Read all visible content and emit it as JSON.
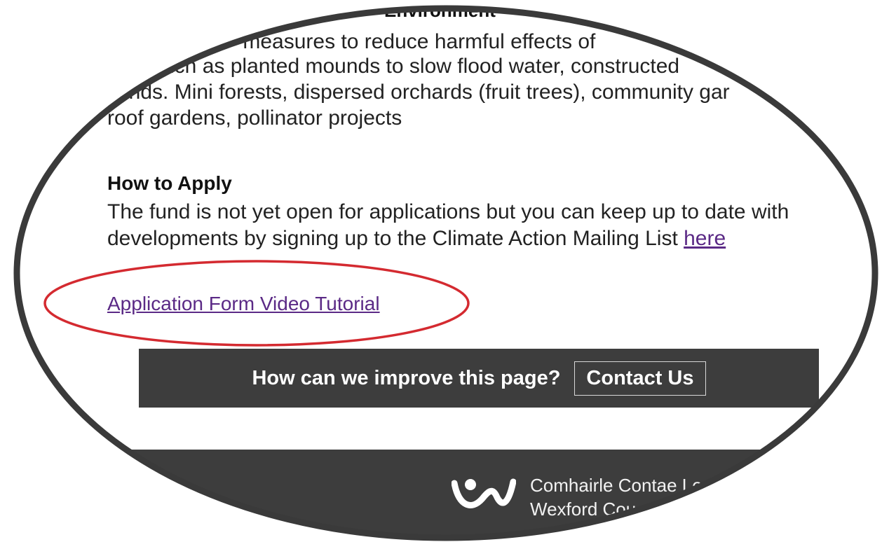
{
  "content": {
    "partial_heading": "Environment",
    "paragraph_lines": [
      "ce - measures to reduce harmful effects of",
      "uch as planted mounds to slow flood water, constructed",
      "tlands. Mini forests, dispersed orchards (fruit trees), community gar",
      "roof gardens, pollinator projects"
    ]
  },
  "how_to_apply": {
    "heading": "How to Apply",
    "text": "The fund is not yet open for applications but you can keep up to date with developments by signing up to the Climate Action Mailing List ",
    "link_label": "here"
  },
  "video_link_label": "Application Form Video Tutorial",
  "feedback": {
    "question": "How can we improve this page?",
    "button_label": "Contact Us"
  },
  "footer": {
    "name_line1": "Comhairle Contae Lo",
    "name_line2": "Wexford Cou"
  },
  "colors": {
    "link": "#5b2a86",
    "bar": "#3d3d3d",
    "highlight_ellipse": "#d42a30",
    "lens_frame": "#3a3a3a"
  }
}
